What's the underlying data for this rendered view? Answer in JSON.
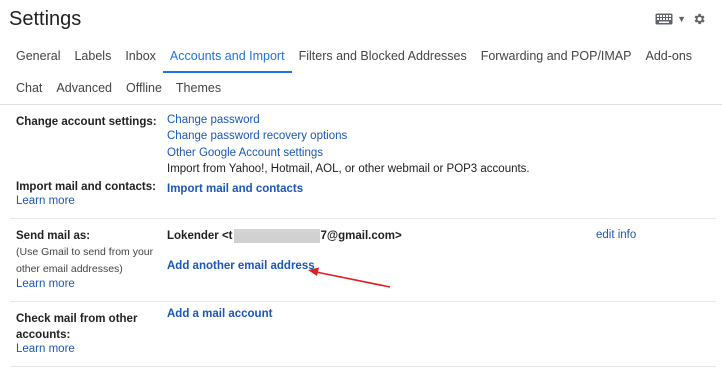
{
  "header": {
    "title": "Settings",
    "keyboard_icon": "keyboard-icon",
    "settings_icon": "gear-icon"
  },
  "tabs_row1": [
    "General",
    "Labels",
    "Inbox",
    "Accounts and Import",
    "Filters and Blocked Addresses",
    "Forwarding and POP/IMAP",
    "Add-ons"
  ],
  "tabs_row2": [
    "Chat",
    "Advanced",
    "Offline",
    "Themes"
  ],
  "active_tab": "Accounts and Import",
  "change_account": {
    "label": "Change account settings:",
    "links": [
      "Change password",
      "Change password recovery options",
      "Other Google Account settings"
    ]
  },
  "import_mail": {
    "label": "Import mail and contacts:",
    "learn_more": "Learn more",
    "description": "Import from Yahoo!, Hotmail, AOL, or other webmail or POP3 accounts.",
    "action": "Import mail and contacts"
  },
  "send_mail": {
    "label": "Send mail as:",
    "sub1": "(Use Gmail to send from your",
    "sub2": "other email addresses)",
    "learn_more": "Learn more",
    "sender_name": "Lokender <t",
    "sender_email_end": "7@gmail.com>",
    "edit_info": "edit info",
    "add_address": "Add another email address"
  },
  "check_mail": {
    "label_line1": "Check mail from other",
    "label_line2": "accounts:",
    "learn_more": "Learn more",
    "add_account": "Add a mail account"
  },
  "colors": {
    "link": "#1a57b8",
    "active_tab": "#1a73e8",
    "annotation_arrow": "#e02020"
  }
}
